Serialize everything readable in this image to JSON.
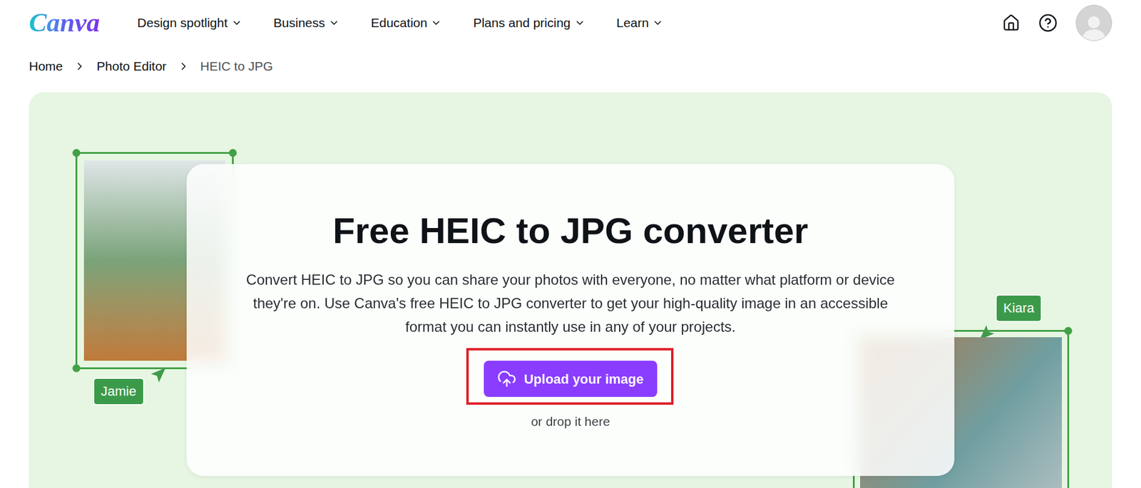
{
  "logo": "Canva",
  "nav": [
    {
      "label": "Design spotlight"
    },
    {
      "label": "Business"
    },
    {
      "label": "Education"
    },
    {
      "label": "Plans and pricing"
    },
    {
      "label": "Learn"
    }
  ],
  "breadcrumb": [
    {
      "label": "Home",
      "current": false
    },
    {
      "label": "Photo Editor",
      "current": false
    },
    {
      "label": "HEIC to JPG",
      "current": true
    }
  ],
  "hero": {
    "title": "Free HEIC to JPG converter",
    "description": "Convert HEIC to JPG so you can share your photos with everyone, no matter what platform or device they're on. Use Canva's free HEIC to JPG converter to get your high-quality image in an accessible format you can instantly use in any of your projects.",
    "upload_button": {
      "label": "Upload your image",
      "highlighted": true
    },
    "drop_hint": "or drop it here"
  },
  "collaborators": [
    {
      "name": "Jamie"
    },
    {
      "name": "Kiara"
    }
  ]
}
